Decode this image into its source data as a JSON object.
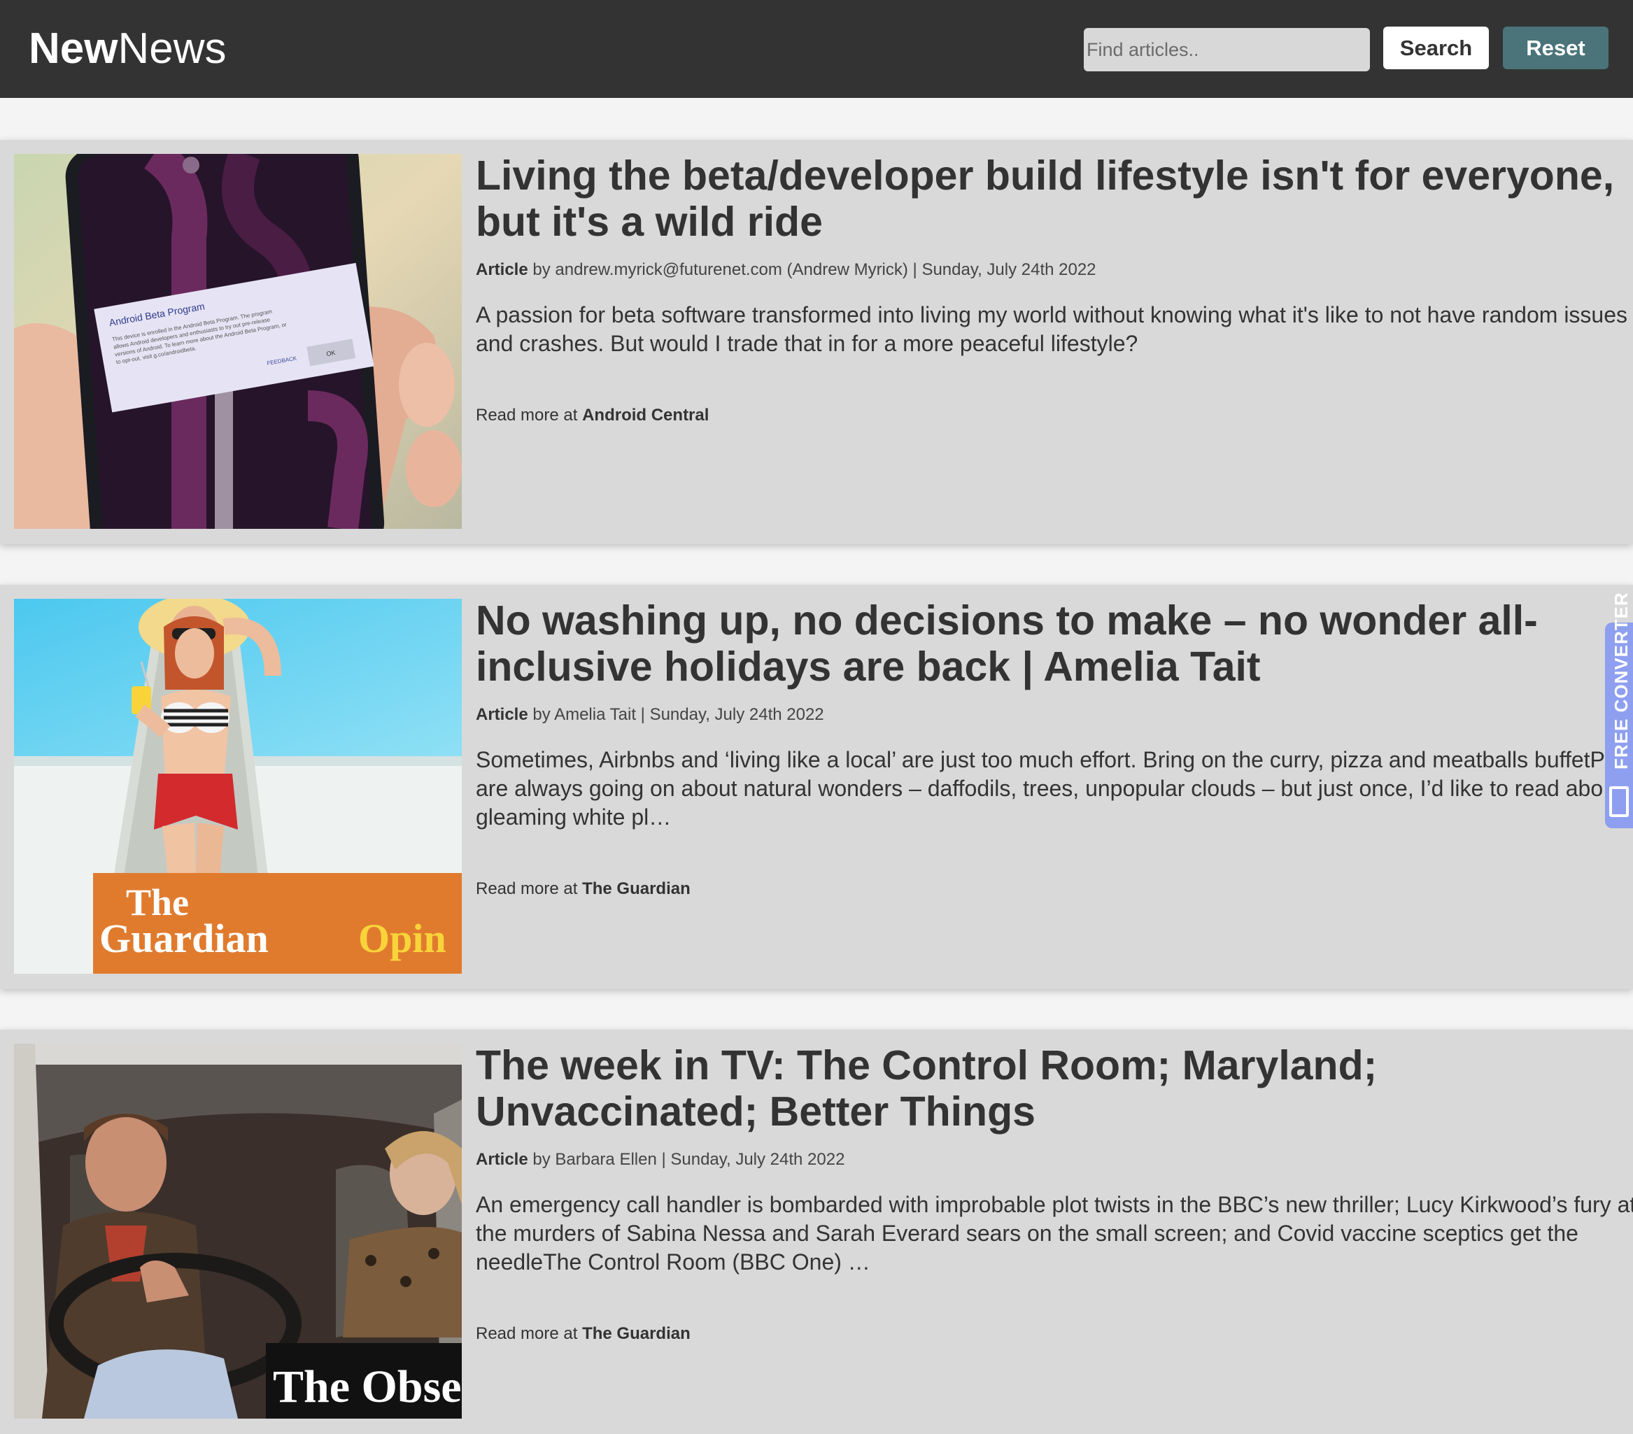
{
  "header": {
    "brand_bold": "New",
    "brand_regular": "News",
    "search_placeholder": "Find articles..",
    "search_label": "Search",
    "reset_label": "Reset"
  },
  "articles": [
    {
      "title_line1": "Living the beta/developer build lifestyle isn't for everyone,",
      "title_line2": "but it's a wild ride",
      "type": "Article",
      "byline": "by andrew.myrick@futurenet.com (Andrew Myrick) | Sunday, July 24th 2022",
      "summary_lines": [
        "A passion for beta software transformed into living my world without knowing what it's like to not have random issues",
        "and crashes. But would I trade that in for a more peaceful lifestyle?"
      ],
      "read_more_prefix": "Read more at",
      "source": "Android Central",
      "image": {
        "dialog_title": "Android Beta Program",
        "dialog_body": [
          "This device is enrolled in the Android Beta Program. The program",
          "allows Android developers and enthusiasts to try out pre-release",
          "versions of Android. To learn more about the Android Beta Program, or",
          "to opt-out, visit g.co/androidbeta."
        ],
        "dialog_feedback": "FEEDBACK",
        "dialog_ok": "OK"
      }
    },
    {
      "title_line1": "No washing up, no decisions to make – no wonder all-",
      "title_line2": "inclusive holidays are back | Amelia Tait",
      "type": "Article",
      "byline": "by Amelia Tait | Sunday, July 24th 2022",
      "summary_lines": [
        "Sometimes, Airbnbs and ‘living like a local’ are just too much effort. Bring on the curry, pizza and meatballs buffetP",
        "are always going on about natural wonders – daffodils, trees, unpopular clouds – but just once, I’d like to read abo",
        "gleaming white pl…"
      ],
      "read_more_prefix": "Read more at",
      "source": "The Guardian",
      "image": {
        "overlay_line1": "The",
        "overlay_line2": "Guardian",
        "overlay_accent": "Opin"
      }
    },
    {
      "title_line1": "The week in TV: The Control Room; Maryland;",
      "title_line2": "Unvaccinated; Better Things",
      "type": "Article",
      "byline": "by Barbara Ellen | Sunday, July 24th 2022",
      "summary_lines": [
        "An emergency call handler is bombarded with improbable plot twists in the BBC’s new thriller; Lucy Kirkwood’s fury at",
        "the murders of Sabina Nessa and Sarah Everard sears on the small screen; and Covid vaccine sceptics get the",
        "needleThe Control Room (BBC One) …"
      ],
      "read_more_prefix": "Read more at",
      "source": "The Guardian",
      "image": {
        "overlay_text": "The Obse"
      }
    }
  ],
  "extension_tab": {
    "label": "FREE CONVERTER",
    "icon": "free-converter-logo-icon"
  },
  "colors": {
    "topbar": "#333333",
    "card": "#d9d9d9",
    "page": "#f4f4f4",
    "reset_button": "#4a7479",
    "guardian_orange": "#e07b2e",
    "extension_tab": "#8e9ff0"
  }
}
